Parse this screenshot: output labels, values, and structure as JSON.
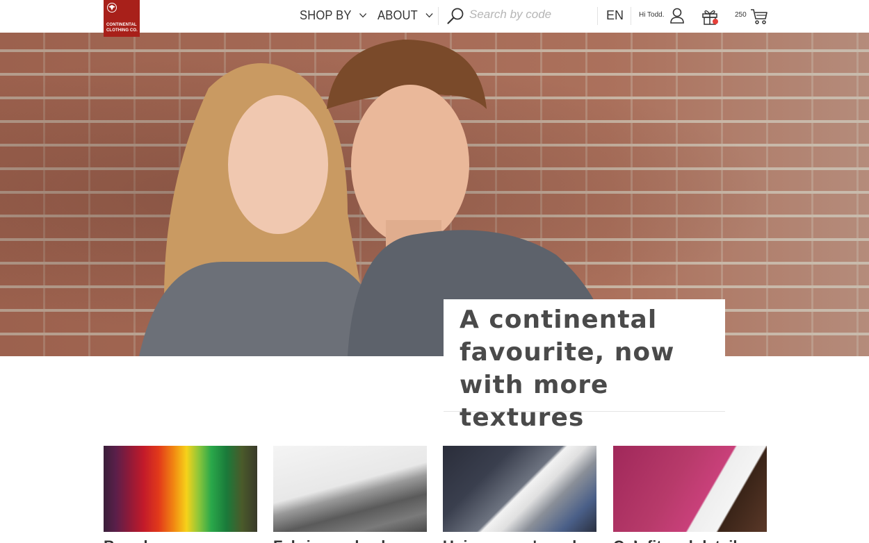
{
  "brand": {
    "name_line1": "CONTINENTAL",
    "name_line2": "CLOTHING CO.",
    "color": "#a8201a"
  },
  "nav": {
    "shop_by": "SHOP BY",
    "about": "ABOUT"
  },
  "search": {
    "placeholder": "Search by code",
    "icon": "search-icon"
  },
  "header": {
    "language": "EN",
    "greeting": "Hi Todd.",
    "cart_count": "250",
    "gift_badge_color": "#e5403a"
  },
  "hero": {
    "headline": "A continental favourite, now with more textures"
  },
  "categories": [
    {
      "title": "Brands",
      "image": "rainbow-tshirts"
    },
    {
      "title": "Fabrics and colours",
      "image": "white-fabric"
    },
    {
      "title": "Unisex, men's and women's",
      "image": "folded-tshirts"
    },
    {
      "title": "Cut, fit and details",
      "image": "tailor-chalk"
    }
  ]
}
